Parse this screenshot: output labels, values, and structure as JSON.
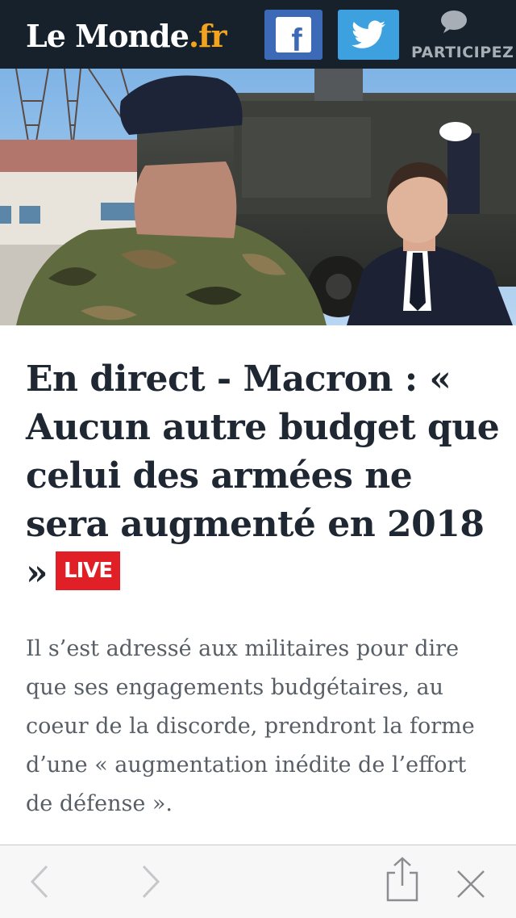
{
  "header": {
    "logo_main": "Le Monde",
    "logo_tld": ".fr",
    "facebook_label": "f",
    "participez_label": "PARTICIPEZ"
  },
  "hero": {
    "icon": "photo-macron-soldier"
  },
  "article": {
    "headline": "En direct - Macron : « Aucun autre budget que celui des armées ne sera augmenté en 2018 »",
    "live_badge": "LIVE",
    "summary": "Il s’est adressé aux militaires pour dire que ses engagements budgétaires, au coeur de la discorde, prendront la forme d’une « augmentation inédite de l’effort de défense »."
  },
  "toolbar": {
    "back_icon": "chevron-left-icon",
    "forward_icon": "chevron-right-icon",
    "share_icon": "share-icon",
    "close_icon": "close-icon"
  },
  "colors": {
    "header_bg": "#16212c",
    "facebook": "#3d6ab6",
    "twitter": "#3da1e0",
    "live": "#e01f26",
    "logo_tld": "#f2a41f"
  }
}
